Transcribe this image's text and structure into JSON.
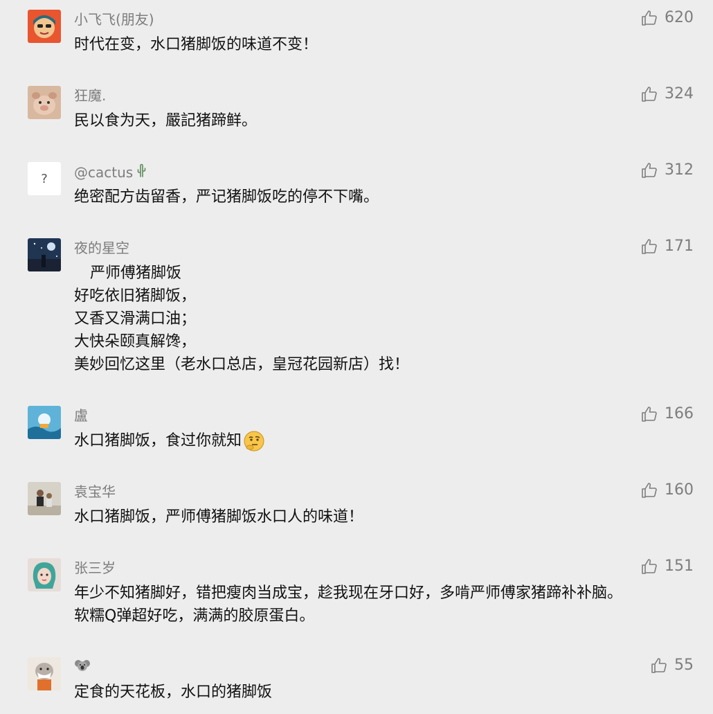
{
  "comments": [
    {
      "name": "小飞飞(朋友)",
      "likes": "620",
      "lines": [
        "时代在变，水口猪脚饭的味道不变！"
      ]
    },
    {
      "name": "狂魔.",
      "likes": "324",
      "lines": [
        "民以食为天，嚴記猪蹄鲜。"
      ]
    },
    {
      "name": "@cactus",
      "likes": "312",
      "avatar_glyph": "?",
      "lines": [
        "绝密配方齿留香，严记猪脚饭吃的停不下嘴。"
      ]
    },
    {
      "name": "夜的星空",
      "likes": "171",
      "lines": [
        "严师傅猪脚饭",
        "好吃依旧猪脚饭，",
        "又香又滑满口油；",
        "大快朵颐真解馋，",
        "美妙回忆这里（老水口总店，皇冠花园新店）找！"
      ]
    },
    {
      "name": "盧",
      "likes": "166",
      "lines": [
        "水口猪脚饭，食过你就知"
      ]
    },
    {
      "name": "袁宝华",
      "likes": "160",
      "lines": [
        "水口猪脚饭，严师傅猪脚饭水口人的味道！"
      ]
    },
    {
      "name": "张三岁",
      "likes": "151",
      "lines": [
        "年少不知猪脚好，错把瘦肉当成宝，趁我现在牙口好，多啃严师傅家猪蹄补补脑。",
        "软糯Q弹超好吃，满满的胶原蛋白。"
      ]
    },
    {
      "name": "",
      "likes": "55",
      "lines": [
        "定食的天花板，水口的猪脚饭"
      ]
    }
  ],
  "icons": {
    "like": "thumbs-up-outline-icon",
    "cactus": "cactus-icon",
    "thinking_emoji": "thinking-face-emoji",
    "koala": "koala-icon"
  },
  "colors": {
    "background": "#ededed",
    "meta_text": "#7d7d7d",
    "body_text": "#111111"
  }
}
